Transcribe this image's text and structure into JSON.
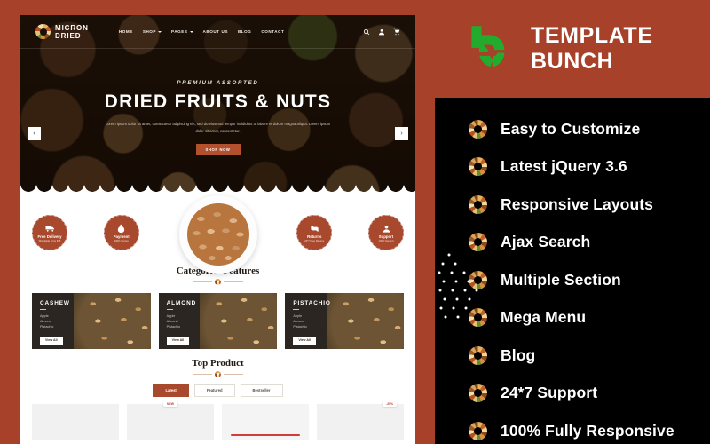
{
  "promo": {
    "brand_name": "TEMPLATE BUNCH",
    "brand_color": "#a8412a",
    "logo_color": "#22ab2c",
    "features": [
      "Easy to Customize",
      "Latest jQuery 3.6",
      "Responsive Layouts",
      "Ajax Search",
      "Multiple Section",
      "Mega Menu",
      "Blog",
      "24*7 Support",
      "100% Fully Responsive"
    ]
  },
  "site": {
    "logo": {
      "line1": "MICRON",
      "line2": "DRIED"
    },
    "nav": [
      {
        "label": "HOME",
        "caret": false
      },
      {
        "label": "SHOP",
        "caret": true
      },
      {
        "label": "PAGES",
        "caret": true
      },
      {
        "label": "ABOUT US",
        "caret": false
      },
      {
        "label": "BLOG",
        "caret": false
      },
      {
        "label": "CONTACT",
        "caret": false
      }
    ],
    "hero": {
      "eyebrow": "PREMIUM ASSORTED",
      "title": "DRIED FRUITS & NUTS",
      "paragraph": "Lorem ipsum dolor sit amet, consectetur adipiscing elit, sed do eiusmod tempor incididunt ut labore et dolore magna aliqua. Lorem ipsum dolor sit amet, consectetur.",
      "cta": "SHOP NOW",
      "prev": "‹",
      "next": "›"
    },
    "badges": [
      {
        "title": "Free Delivery",
        "subtitle": "Worldwide From $75",
        "icon": "truck-icon"
      },
      {
        "title": "Payment",
        "subtitle": "100% Secure",
        "icon": "money-bag-icon"
      },
      {
        "title": "Returns",
        "subtitle": "24*7 Free Returns",
        "icon": "return-icon"
      },
      {
        "title": "Support",
        "subtitle": "100% Support",
        "icon": "support-agent-icon"
      }
    ],
    "categories_section": {
      "heading": "Categories Features",
      "cards": [
        {
          "title": "CASHEW",
          "items": [
            "Apple",
            "Almond",
            "Pistachio"
          ],
          "button": "View All"
        },
        {
          "title": "ALMOND",
          "items": [
            "Apple",
            "Almond",
            "Pistachio"
          ],
          "button": "View All"
        },
        {
          "title": "PISTACHIO",
          "items": [
            "Apple",
            "Almond",
            "Pistachio"
          ],
          "button": "View All"
        }
      ]
    },
    "top_product": {
      "heading": "Top Product",
      "tabs": [
        {
          "label": "Latest",
          "active": true
        },
        {
          "label": "Featured",
          "active": false
        },
        {
          "label": "Bestseller",
          "active": false
        }
      ],
      "products": [
        {
          "tag": ""
        },
        {
          "tag": "NEW"
        },
        {
          "tag": ""
        },
        {
          "tag": "-20%"
        }
      ]
    }
  }
}
